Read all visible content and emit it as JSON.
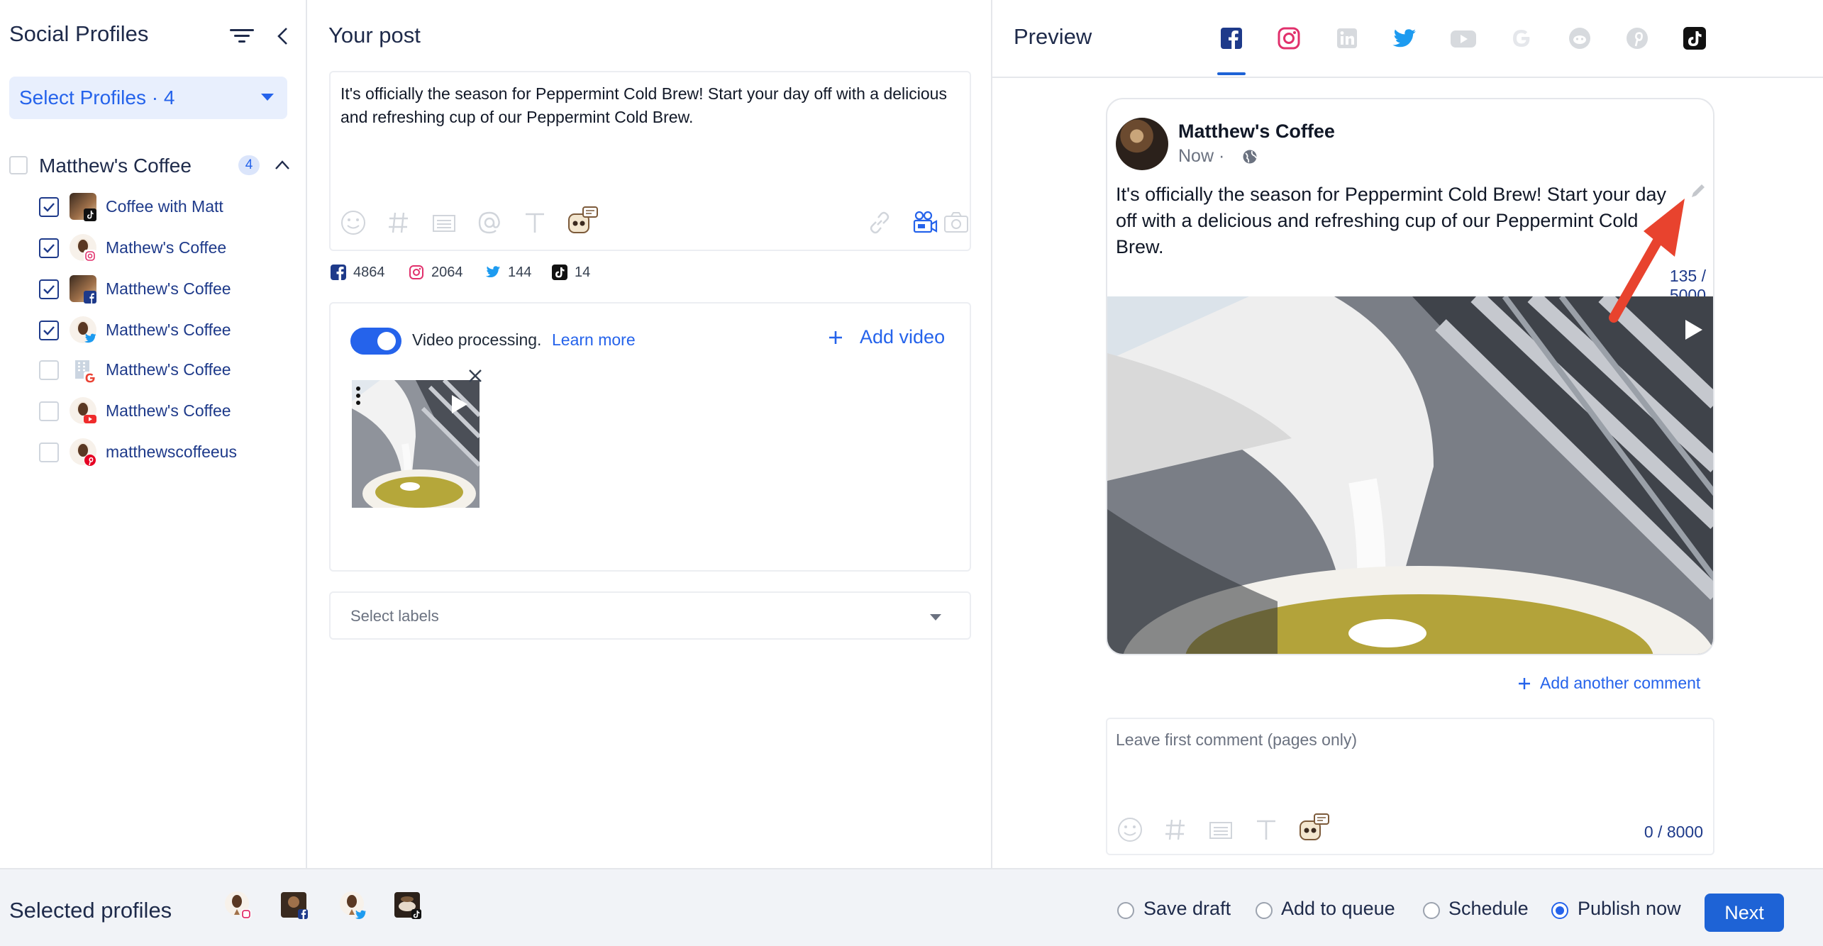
{
  "sidebar": {
    "title": "Social Profiles",
    "select_profiles_label": "Select Profiles · 4",
    "group": {
      "name": "Matthew's Coffee",
      "count": "4"
    },
    "profiles": [
      {
        "label": "Coffee with Matt",
        "checked": true,
        "network": "tiktok"
      },
      {
        "label": "Mathew's Coffee",
        "checked": true,
        "network": "instagram"
      },
      {
        "label": "Matthew's Coffee",
        "checked": true,
        "network": "facebook"
      },
      {
        "label": "Matthew's Coffee",
        "checked": true,
        "network": "twitter"
      },
      {
        "label": "Matthew's Coffee",
        "checked": false,
        "network": "google"
      },
      {
        "label": "Matthew's Coffee",
        "checked": false,
        "network": "youtube"
      },
      {
        "label": "matthewscoffeeus",
        "checked": false,
        "network": "pinterest"
      }
    ]
  },
  "post": {
    "title": "Your post",
    "text": "It's officially the season for Peppermint Cold Brew! Start your day off with a delicious and refreshing cup of our Peppermint Cold Brew.",
    "counts": [
      {
        "network": "facebook",
        "value": "4864"
      },
      {
        "network": "instagram",
        "value": "2064"
      },
      {
        "network": "twitter",
        "value": "144"
      },
      {
        "network": "tiktok",
        "value": "14"
      }
    ],
    "video_processing_label": "Video processing.",
    "learn_more": "Learn more",
    "add_video": "Add video",
    "labels_placeholder": "Select labels"
  },
  "preview": {
    "title": "Preview",
    "tabs": [
      "facebook",
      "instagram",
      "linkedin",
      "twitter",
      "youtube",
      "google",
      "reddit",
      "pinterest",
      "tiktok"
    ],
    "active_tab": "facebook",
    "card": {
      "name": "Matthew's Coffee",
      "time": "Now ·",
      "text": "It's officially the season for Peppermint Cold Brew! Start your day off with a delicious and refreshing cup of our Peppermint Cold Brew.",
      "char_count": "135 / 5000"
    },
    "add_comment": "Add another comment",
    "comment_placeholder": "Leave first comment (pages only)",
    "comment_count": "0 / 8000"
  },
  "footer": {
    "title": "Selected profiles",
    "options": [
      {
        "label": "Save draft",
        "selected": false
      },
      {
        "label": "Add to queue",
        "selected": false
      },
      {
        "label": "Schedule",
        "selected": false
      },
      {
        "label": "Publish now",
        "selected": true
      }
    ],
    "next_label": "Next"
  },
  "colors": {
    "accent": "#2563eb",
    "facebook": "#1877f2",
    "instagram": "#e1306c",
    "twitter": "#1d9bf0",
    "arrow": "#e8432e"
  }
}
